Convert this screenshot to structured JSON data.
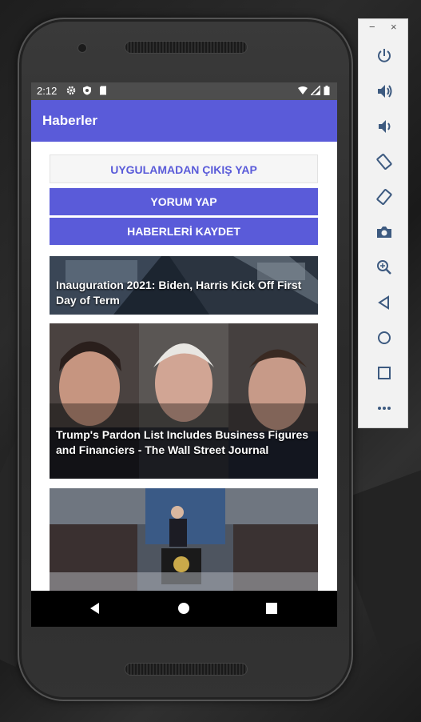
{
  "status_bar": {
    "time": "2:12",
    "icons": [
      "settings-icon",
      "shield-icon",
      "sd-card-icon",
      "wifi-icon",
      "signal-icon",
      "battery-icon"
    ]
  },
  "app_bar": {
    "title": "Haberler"
  },
  "buttons": {
    "exit_label": "UYGULAMADAN ÇIKIŞ YAP",
    "comment_label": "YORUM YAP",
    "save_label": "HABERLERİ KAYDET"
  },
  "news": [
    {
      "title": "Inauguration 2021: Biden, Harris Kick Off First Day of Term"
    },
    {
      "title": "Trump's Pardon List Includes Business Figures and Financiers - The Wall Street Journal"
    },
    {
      "title": ""
    }
  ],
  "emulator_toolbar": {
    "window_controls": {
      "minimize": "−",
      "close": "×"
    },
    "tools": [
      "power-icon",
      "volume-up-icon",
      "volume-down-icon",
      "rotate-left-icon",
      "rotate-right-icon",
      "camera-icon",
      "zoom-icon",
      "back-icon",
      "home-icon",
      "overview-icon",
      "more-icon"
    ]
  },
  "colors": {
    "primary": "#5a5bd9",
    "status_bar": "#4d4d4d",
    "nav_bar": "#000000",
    "exit_button_bg": "#f6f6f6"
  }
}
